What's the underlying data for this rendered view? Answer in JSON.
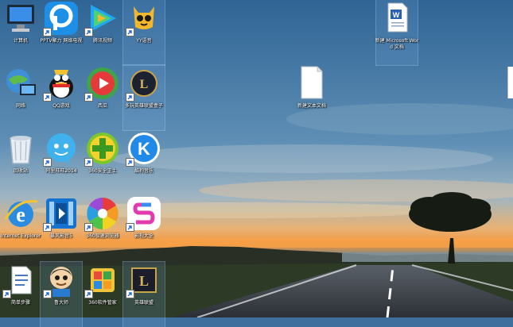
{
  "desktop": {
    "icons": [
      {
        "label": "计算机",
        "icon": "computer-icon",
        "shortcut": false
      },
      {
        "label": "PPTV聚力 网络电视",
        "icon": "pptv-icon",
        "shortcut": true
      },
      {
        "label": "腾讯视频",
        "icon": "tencent-video-icon",
        "shortcut": true
      },
      {
        "label": "YY语音",
        "icon": "yy-voice-icon",
        "shortcut": true
      },
      {
        "label": "新建 Microsoft Word 文档",
        "icon": "word-document-icon",
        "shortcut": false
      },
      {
        "label": "网络",
        "icon": "network-icon",
        "shortcut": false
      },
      {
        "label": "QQ游戏",
        "icon": "qq-game-icon",
        "shortcut": true
      },
      {
        "label": "西瓜",
        "icon": "xigua-video-icon",
        "shortcut": true
      },
      {
        "label": "多玩英雄联盟盒子",
        "icon": "lol-box-icon",
        "shortcut": true
      },
      {
        "label": "新建文本文档",
        "icon": "text-document-icon",
        "shortcut": false
      },
      {
        "label": "回收站",
        "icon": "recycle-bin-icon",
        "shortcut": false
      },
      {
        "label": "阿里旺旺2014",
        "icon": "aliwangwang-icon",
        "shortcut": true
      },
      {
        "label": "360安全卫士",
        "icon": "360-security-icon",
        "shortcut": true
      },
      {
        "label": "酷狗音乐",
        "icon": "kugou-music-icon",
        "shortcut": true
      },
      {
        "label": "Internet Explorer",
        "icon": "internet-explorer-icon",
        "shortcut": false
      },
      {
        "label": "暴风影音5",
        "icon": "baofeng-player-icon",
        "shortcut": true
      },
      {
        "label": "360极速浏览器",
        "icon": "360-browser-icon",
        "shortcut": true
      },
      {
        "label": "影视大全",
        "icon": "video-app-icon",
        "shortcut": true
      },
      {
        "label": "简单步骤",
        "icon": "document-icon",
        "shortcut": true
      },
      {
        "label": "鲁大师",
        "icon": "ludashi-icon",
        "shortcut": true
      },
      {
        "label": "360软件管家",
        "icon": "360-software-manager-icon",
        "shortcut": true
      },
      {
        "label": "英雄联盟",
        "icon": "league-of-legends-icon",
        "shortcut": true
      }
    ]
  },
  "colors": {
    "sky_top": "#35699a",
    "sky_mid": "#6f9bbd",
    "sunset": "#f2a54a",
    "ground": "#233020"
  }
}
